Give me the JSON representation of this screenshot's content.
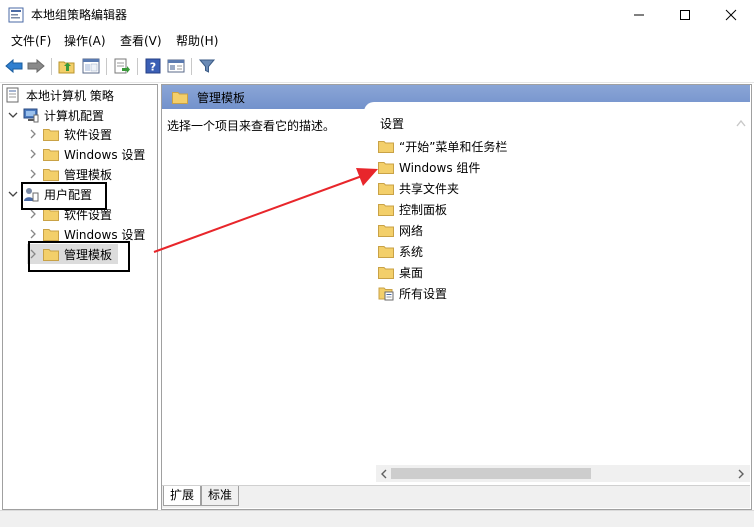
{
  "window": {
    "title": "本地组策略编辑器",
    "minimize_glyph": "—",
    "maximize_glyph": "☐",
    "close_glyph": "✕"
  },
  "menu": {
    "items": [
      "文件(F)",
      "操作(A)",
      "查看(V)",
      "帮助(H)"
    ]
  },
  "toolbar": {
    "icons": [
      "back-arrow-icon",
      "forward-arrow-icon",
      "up-folder-icon",
      "show-hide-tree-icon",
      "export-list-icon",
      "help-icon",
      "properties-icon",
      "filter-icon"
    ]
  },
  "tree": {
    "root": "本地计算机 策略",
    "computer_config": "计算机配置",
    "computer_children": [
      "软件设置",
      "Windows 设置",
      "管理模板"
    ],
    "user_config": "用户配置",
    "user_children": [
      "软件设置",
      "Windows 设置",
      "管理模板"
    ]
  },
  "details": {
    "header": "管理模板",
    "description": "选择一个项目来查看它的描述。",
    "column_header": "设置",
    "items": [
      "“开始”菜单和任务栏",
      "Windows 组件",
      "共享文件夹",
      "控制面板",
      "网络",
      "系统",
      "桌面",
      "所有设置"
    ]
  },
  "tabs": [
    "扩展",
    "标准"
  ],
  "colors": {
    "header_blue": "#7a9ad0",
    "folder_yellow": "#f3cf6a",
    "arrow_red": "#e8262b"
  }
}
